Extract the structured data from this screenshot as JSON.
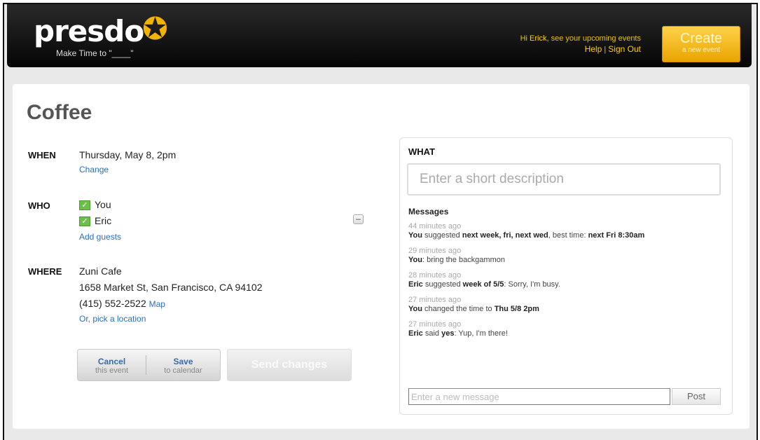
{
  "header": {
    "logo": "presdo",
    "tagline": "Make Time to \"____\"",
    "greeting_prefix": "Hi ",
    "user_name": "Erick",
    "greeting_suffix": ", see your upcoming events",
    "help_label": "Help",
    "separator": " | ",
    "signout_label": "Sign Out",
    "create_label": "Create",
    "create_sublabel": "a new event"
  },
  "event": {
    "title": "Coffee",
    "when_label": "WHEN",
    "when_value": "Thursday, May 8, 2pm",
    "change_link": "Change",
    "who_label": "WHO",
    "guests": [
      "You",
      "Eric"
    ],
    "add_guests_link": "Add guests",
    "where_label": "WHERE",
    "place_name": "Zuni Cafe",
    "address": "1658 Market St, San Francisco, CA 94102",
    "phone": "(415) 552-2522",
    "map_link": "Map",
    "pick_location_link": "Or, pick a location"
  },
  "actions": {
    "cancel_label": "Cancel",
    "cancel_sub": "this event",
    "save_label": "Save",
    "save_sub": "to calendar",
    "send_label": "Send changes"
  },
  "panel": {
    "what_label": "WHAT",
    "description_placeholder": "Enter a short description",
    "messages_label": "Messages",
    "messages": [
      {
        "time": "44 minutes ago",
        "parts": [
          [
            "b",
            "You"
          ],
          [
            "t",
            " suggested "
          ],
          [
            "b",
            "next week, fri, next wed"
          ],
          [
            "t",
            ", best time: "
          ],
          [
            "b",
            "next Fri 8:30am"
          ]
        ]
      },
      {
        "time": "29 minutes ago",
        "parts": [
          [
            "b",
            "You"
          ],
          [
            "t",
            ": bring the backgammon"
          ]
        ]
      },
      {
        "time": "28 minutes ago",
        "parts": [
          [
            "b",
            "Eric"
          ],
          [
            "t",
            " suggested "
          ],
          [
            "b",
            "week of 5/5"
          ],
          [
            "t",
            ": Sorry, I'm busy."
          ]
        ]
      },
      {
        "time": "27 minutes ago",
        "parts": [
          [
            "b",
            "You"
          ],
          [
            "t",
            " changed the time to "
          ],
          [
            "b",
            "Thu 5/8 2pm"
          ]
        ]
      },
      {
        "time": "27 minutes ago",
        "parts": [
          [
            "b",
            "Eric"
          ],
          [
            "t",
            " said "
          ],
          [
            "b",
            "yes"
          ],
          [
            "t",
            ": Yup, I'm there!"
          ]
        ]
      }
    ],
    "new_message_placeholder": "Enter a new message",
    "post_label": "Post"
  },
  "colors": {
    "accent": "#f2b400",
    "link": "#2b6fb6",
    "check": "#6cc04a"
  }
}
